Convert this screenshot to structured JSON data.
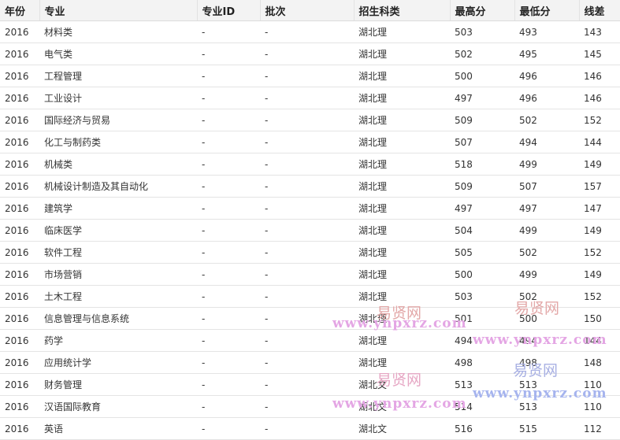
{
  "table": {
    "headers": [
      "年份",
      "专业",
      "专业ID",
      "批次",
      "招生科类",
      "最高分",
      "最低分",
      "线差"
    ],
    "rows": [
      [
        "2016",
        "材料类",
        "-",
        "-",
        "湖北理",
        "503",
        "493",
        "143"
      ],
      [
        "2016",
        "电气类",
        "-",
        "-",
        "湖北理",
        "502",
        "495",
        "145"
      ],
      [
        "2016",
        "工程管理",
        "-",
        "-",
        "湖北理",
        "500",
        "496",
        "146"
      ],
      [
        "2016",
        "工业设计",
        "-",
        "-",
        "湖北理",
        "497",
        "496",
        "146"
      ],
      [
        "2016",
        "国际经济与贸易",
        "-",
        "-",
        "湖北理",
        "509",
        "502",
        "152"
      ],
      [
        "2016",
        "化工与制药类",
        "-",
        "-",
        "湖北理",
        "507",
        "494",
        "144"
      ],
      [
        "2016",
        "机械类",
        "-",
        "-",
        "湖北理",
        "518",
        "499",
        "149"
      ],
      [
        "2016",
        "机械设计制造及其自动化",
        "-",
        "-",
        "湖北理",
        "509",
        "507",
        "157"
      ],
      [
        "2016",
        "建筑学",
        "-",
        "-",
        "湖北理",
        "497",
        "497",
        "147"
      ],
      [
        "2016",
        "临床医学",
        "-",
        "-",
        "湖北理",
        "504",
        "499",
        "149"
      ],
      [
        "2016",
        "软件工程",
        "-",
        "-",
        "湖北理",
        "505",
        "502",
        "152"
      ],
      [
        "2016",
        "市场营销",
        "-",
        "-",
        "湖北理",
        "500",
        "499",
        "149"
      ],
      [
        "2016",
        "土木工程",
        "-",
        "-",
        "湖北理",
        "503",
        "502",
        "152"
      ],
      [
        "2016",
        "信息管理与信息系统",
        "-",
        "-",
        "湖北理",
        "501",
        "500",
        "150"
      ],
      [
        "2016",
        "药学",
        "-",
        "-",
        "湖北理",
        "494",
        "494",
        "144"
      ],
      [
        "2016",
        "应用统计学",
        "-",
        "-",
        "湖北理",
        "498",
        "498",
        "148"
      ],
      [
        "2016",
        "财务管理",
        "-",
        "-",
        "湖北文",
        "513",
        "513",
        "110"
      ],
      [
        "2016",
        "汉语国际教育",
        "-",
        "-",
        "湖北文",
        "514",
        "513",
        "110"
      ],
      [
        "2016",
        "英语",
        "-",
        "-",
        "湖北文",
        "516",
        "515",
        "112"
      ]
    ]
  },
  "watermarks": [
    {
      "text": "易贤网",
      "color": "#e3a8a8"
    },
    {
      "text": "www.ynpxrz.com",
      "color": "#e4a6e4"
    },
    {
      "text": "易贤网",
      "color": "#e3a8a8"
    },
    {
      "text": "www.ynpxrz.com",
      "color": "#e4a6e4"
    },
    {
      "text": "易贤网",
      "color": "#e6a7c4"
    },
    {
      "text": "www.ynpxrz.com",
      "color": "#e4a6e4"
    },
    {
      "text": "易贤网",
      "color": "#a8b0e3"
    },
    {
      "text": "www.ynpxrz.com",
      "color": "#a6b4ee"
    }
  ]
}
